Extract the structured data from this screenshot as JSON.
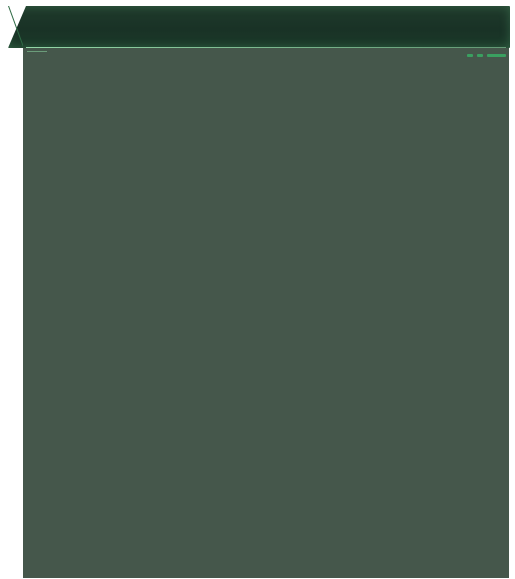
{
  "colors": {
    "header_dark": "#1b3628",
    "panel_background": "#45574b",
    "accent_green": "#3aa060",
    "page_background": "#ffffff"
  },
  "header": {
    "title": ""
  },
  "status_indicators": {
    "icons": [
      "status-dot-icon",
      "status-dot-icon",
      "status-bar-icon"
    ]
  }
}
